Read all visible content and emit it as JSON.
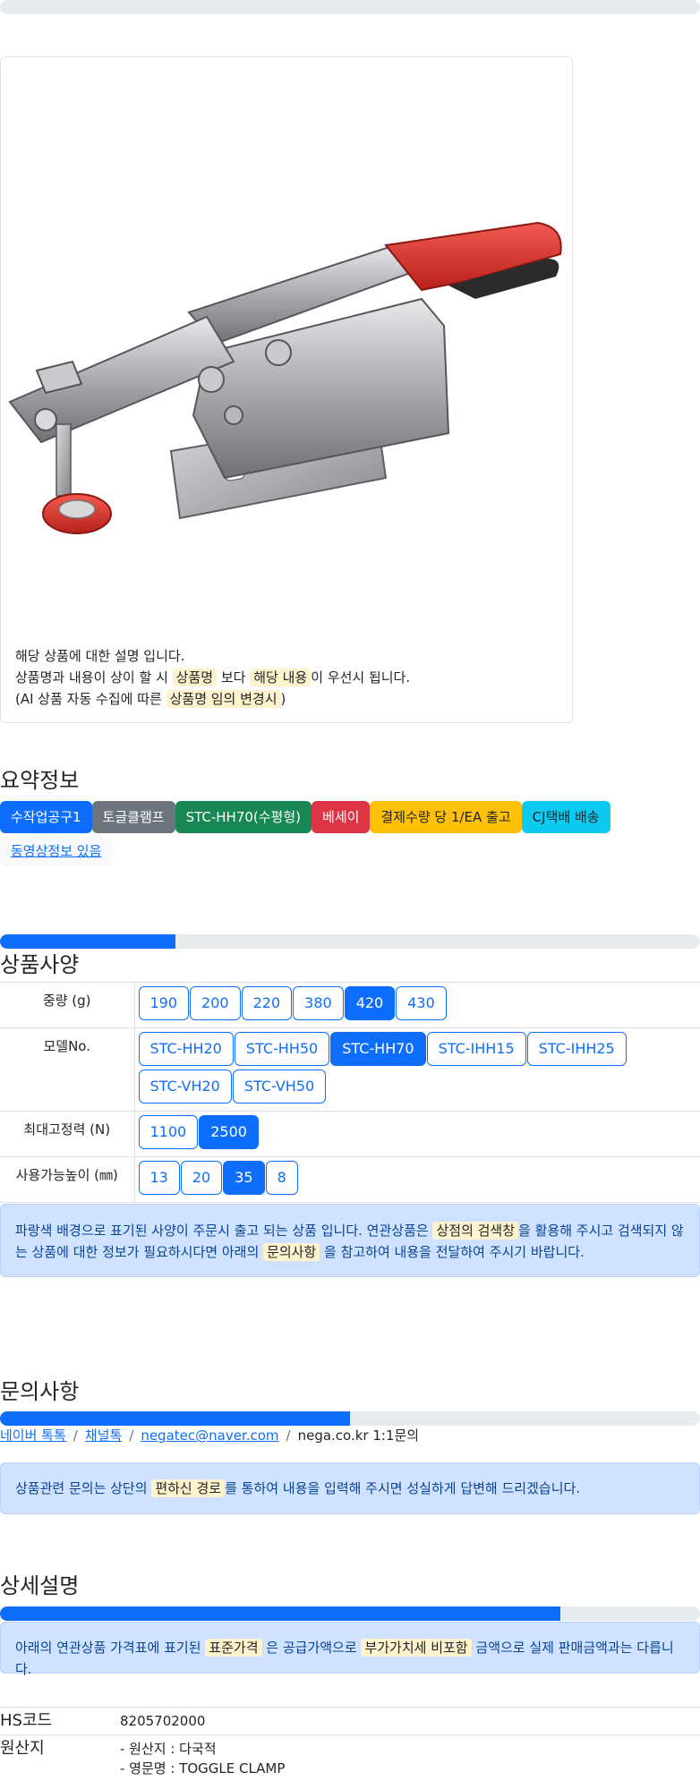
{
  "top_progress": 0,
  "product_card": {
    "image_name": "toggle-clamp-product-photo",
    "desc_line1": "해당 상품에 대한 설명 입니다.",
    "desc_line2_a": "상품명과 내용이 상이 할 시",
    "desc_line2_mark1": "상품명",
    "desc_line2_b": "보다",
    "desc_line2_mark2": "해당 내용",
    "desc_line2_c": "이 우선시 됩니다.",
    "desc_line3_a": "(AI 상품 자동 수집에 따른",
    "desc_line3_mark": "상품명 임의 변경시",
    "desc_line3_b": ")"
  },
  "summary": {
    "title": "요약정보",
    "badges": [
      {
        "label": "수작업공구1",
        "color": "#0d6efd",
        "text": "#ffffff"
      },
      {
        "label": "토글클램프",
        "color": "#6c757d",
        "text": "#ffffff"
      },
      {
        "label": "STC-HH70(수평형)",
        "color": "#198754",
        "text": "#ffffff"
      },
      {
        "label": "베세이",
        "color": "#dc3545",
        "text": "#ffffff"
      },
      {
        "label": "결제수량 당 1/EA 출고",
        "color": "#ffc107",
        "text": "#212529"
      },
      {
        "label": "CJ택배 배송",
        "color": "#0dcaf0",
        "text": "#212529"
      }
    ],
    "video_link": "동영상정보 있음"
  },
  "specs": {
    "progress": 0.25,
    "title": "상품사양",
    "rows": [
      {
        "label": "중량 (g)",
        "options": [
          "190",
          "200",
          "220",
          "380",
          "420",
          "430"
        ],
        "selected": "420"
      },
      {
        "label": "모델No.",
        "options": [
          "STC-HH20",
          "STC-HH50",
          "STC-HH70",
          "STC-IHH15",
          "STC-IHH25",
          "STC-VH20",
          "STC-VH50"
        ],
        "selected": "STC-HH70"
      },
      {
        "label": "최대고정력 (N)",
        "options": [
          "1100",
          "2500"
        ],
        "selected": "2500"
      },
      {
        "label": "사용가능높이 (㎜)",
        "options": [
          "13",
          "20",
          "35",
          "8"
        ],
        "selected": "35"
      }
    ],
    "notice_a": "파랑색 배경으로 표기된 사양이 주문시 출고 되는 상품 입니다. 연관상품은",
    "notice_mark1": "상점의 검색창",
    "notice_b": "을 활용해 주시고 검색되지 않는 상품에 대한 정보가 필요하시다면 아래의",
    "notice_mark2": "문의사항",
    "notice_c": "을 참고하여 내용을 전달하여 주시기 바랍니다."
  },
  "inquiry": {
    "title": "문의사항",
    "progress": 0.5,
    "link_naver": "네이버 톡톡",
    "link_channel": "채널톡",
    "link_email": "negatec@naver.com",
    "site_text": "nega.co.kr 1:1문의",
    "notice_a": "상품관련 문의는 상단의",
    "notice_mark": "편하신 경로",
    "notice_b": "를 통하여 내용을 입력해 주시면 성실하게 답변해 드리겠습니다."
  },
  "detail": {
    "title": "상세설명",
    "progress": 0.8,
    "notice_a": "아래의 연관상품 가격표에 표기된",
    "notice_mark1": "표준가격",
    "notice_b": "은 공급가액으로",
    "notice_mark2": "부가가치세 비포함",
    "notice_c": "금액으로 실제 판매금액과는 다릅니다.",
    "hs_label": "HS코드",
    "hs_value": "8205702000",
    "origin_label": "원산지",
    "origin_line1": "- 원산지 : 다국적",
    "origin_line2": "- 영문명 : TOGGLE CLAMP"
  }
}
